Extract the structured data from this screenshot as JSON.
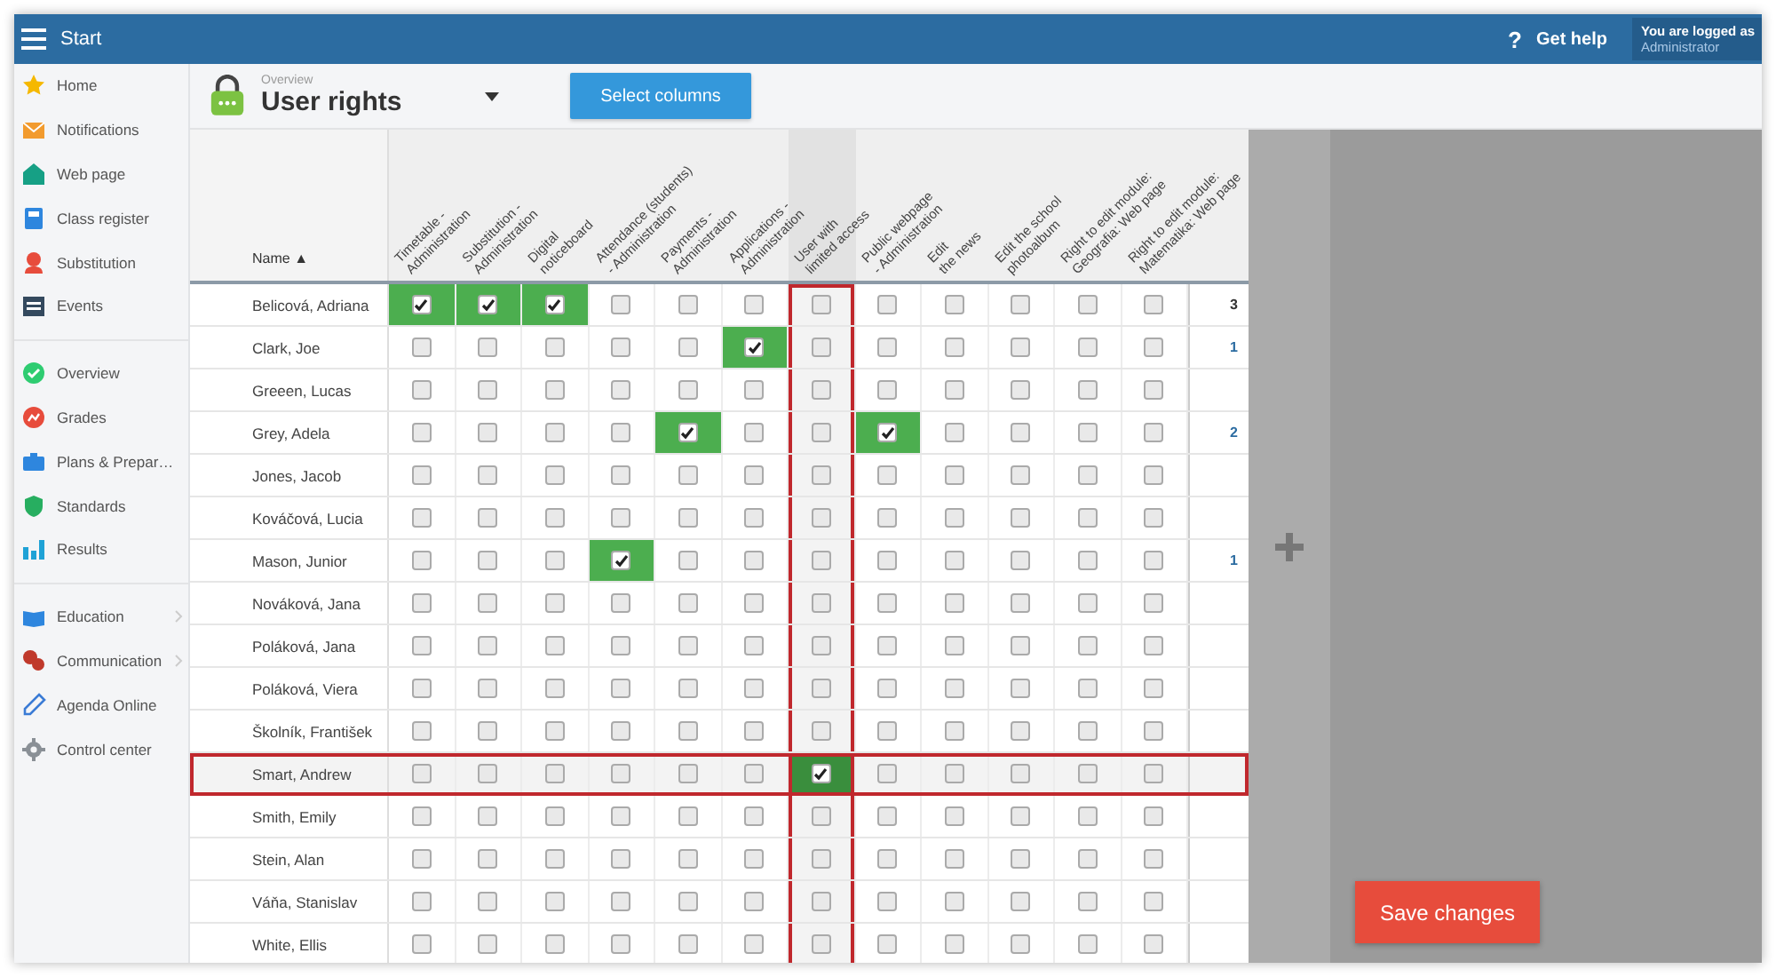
{
  "top_bar": {
    "menu_label": "Start",
    "help": {
      "icon": "?",
      "label": "Get help"
    },
    "login": {
      "caption": "You are logged as",
      "user": "Administrator"
    }
  },
  "sidebar": {
    "groups": [
      {
        "items": [
          {
            "label": "Home",
            "has_submenu": false
          },
          {
            "label": "Notifications",
            "has_submenu": false
          },
          {
            "label": "Web page",
            "has_submenu": false
          },
          {
            "label": "Class register",
            "has_submenu": false
          },
          {
            "label": "Substitution",
            "has_submenu": false
          },
          {
            "label": "Events",
            "has_submenu": false
          }
        ]
      },
      {
        "items": [
          {
            "label": "Overview",
            "has_submenu": false
          },
          {
            "label": "Grades",
            "has_submenu": false
          },
          {
            "label": "Plans & Prepar…",
            "has_submenu": false
          },
          {
            "label": "Standards",
            "has_submenu": false
          },
          {
            "label": "Results",
            "has_submenu": false
          }
        ]
      },
      {
        "items": [
          {
            "label": "Education",
            "has_submenu": true
          },
          {
            "label": "Communication",
            "has_submenu": true
          },
          {
            "label": "Agenda Online",
            "has_submenu": false
          },
          {
            "label": "Control center",
            "has_submenu": false
          }
        ]
      }
    ]
  },
  "toolbar": {
    "breadcrumb": "Overview",
    "title": "User rights",
    "button": "Select columns"
  },
  "table": {
    "name_header": "Name",
    "sort_indicator": "▲",
    "columns": [
      {
        "label": "Timetable -\nAdministration",
        "highlighted": false
      },
      {
        "label": "Substitution -\nAdministration",
        "highlighted": false
      },
      {
        "label": "Digital\nnoticeboard",
        "highlighted": false
      },
      {
        "label": "Attendance (students)\n- Administration",
        "highlighted": false
      },
      {
        "label": "Payments -\nAdministration",
        "highlighted": false
      },
      {
        "label": "Applications -\nAdministration",
        "highlighted": false
      },
      {
        "label": "User with\nlimited access",
        "highlighted": true
      },
      {
        "label": "Public webpage\n- Administration",
        "highlighted": false
      },
      {
        "label": "Edit\nthe news",
        "highlighted": false
      },
      {
        "label": "Edit the school\nphotoalbum",
        "highlighted": false
      },
      {
        "label": "Right to edit module:\nGeografia: Web page",
        "highlighted": false
      },
      {
        "label": "Right to edit module:\nMatematika: Web page",
        "highlighted": false
      }
    ],
    "rows": [
      {
        "name": "Belicová, Adriana",
        "selected": false,
        "count": "3",
        "checks": [
          true,
          true,
          true,
          false,
          false,
          false,
          false,
          false,
          false,
          false,
          false,
          false
        ]
      },
      {
        "name": "Clark, Joe",
        "selected": false,
        "count": "1",
        "checks": [
          false,
          false,
          false,
          false,
          false,
          true,
          false,
          false,
          false,
          false,
          false,
          false
        ]
      },
      {
        "name": "Greeen, Lucas",
        "selected": false,
        "checks": [
          false,
          false,
          false,
          false,
          false,
          false,
          false,
          false,
          false,
          false,
          false,
          false
        ]
      },
      {
        "name": "Grey, Adela",
        "selected": false,
        "count": "2",
        "checks": [
          false,
          false,
          false,
          false,
          true,
          false,
          false,
          true,
          false,
          false,
          false,
          false
        ]
      },
      {
        "name": "Jones, Jacob",
        "selected": false,
        "checks": [
          false,
          false,
          false,
          false,
          false,
          false,
          false,
          false,
          false,
          false,
          false,
          false
        ]
      },
      {
        "name": "Kováčová, Lucia",
        "selected": false,
        "checks": [
          false,
          false,
          false,
          false,
          false,
          false,
          false,
          false,
          false,
          false,
          false,
          false
        ]
      },
      {
        "name": "Mason, Junior",
        "selected": false,
        "count": "1",
        "checks": [
          false,
          false,
          false,
          true,
          false,
          false,
          false,
          false,
          false,
          false,
          false,
          false
        ]
      },
      {
        "name": "Nováková, Jana",
        "selected": false,
        "checks": [
          false,
          false,
          false,
          false,
          false,
          false,
          false,
          false,
          false,
          false,
          false,
          false
        ]
      },
      {
        "name": "Poláková, Jana",
        "selected": false,
        "checks": [
          false,
          false,
          false,
          false,
          false,
          false,
          false,
          false,
          false,
          false,
          false,
          false
        ]
      },
      {
        "name": "Poláková, Viera",
        "selected": false,
        "checks": [
          false,
          false,
          false,
          false,
          false,
          false,
          false,
          false,
          false,
          false,
          false,
          false
        ]
      },
      {
        "name": "Školník, František",
        "selected": false,
        "checks": [
          false,
          false,
          false,
          false,
          false,
          false,
          false,
          false,
          false,
          false,
          false,
          false
        ]
      },
      {
        "name": "Smart, Andrew",
        "selected": true,
        "checks": [
          false,
          false,
          false,
          false,
          false,
          false,
          true,
          false,
          false,
          false,
          false,
          false
        ]
      },
      {
        "name": "Smith, Emily",
        "selected": false,
        "checks": [
          false,
          false,
          false,
          false,
          false,
          false,
          false,
          false,
          false,
          false,
          false,
          false
        ]
      },
      {
        "name": "Stein, Alan",
        "selected": false,
        "checks": [
          false,
          false,
          false,
          false,
          false,
          false,
          false,
          false,
          false,
          false,
          false,
          false
        ]
      },
      {
        "name": "Váňa, Stanislav",
        "selected": false,
        "checks": [
          false,
          false,
          false,
          false,
          false,
          false,
          false,
          false,
          false,
          false,
          false,
          false
        ]
      },
      {
        "name": "White, Ellis",
        "selected": false,
        "checks": [
          false,
          false,
          false,
          false,
          false,
          false,
          false,
          false,
          false,
          false,
          false,
          false
        ]
      }
    ]
  },
  "save_button": "Save changes"
}
